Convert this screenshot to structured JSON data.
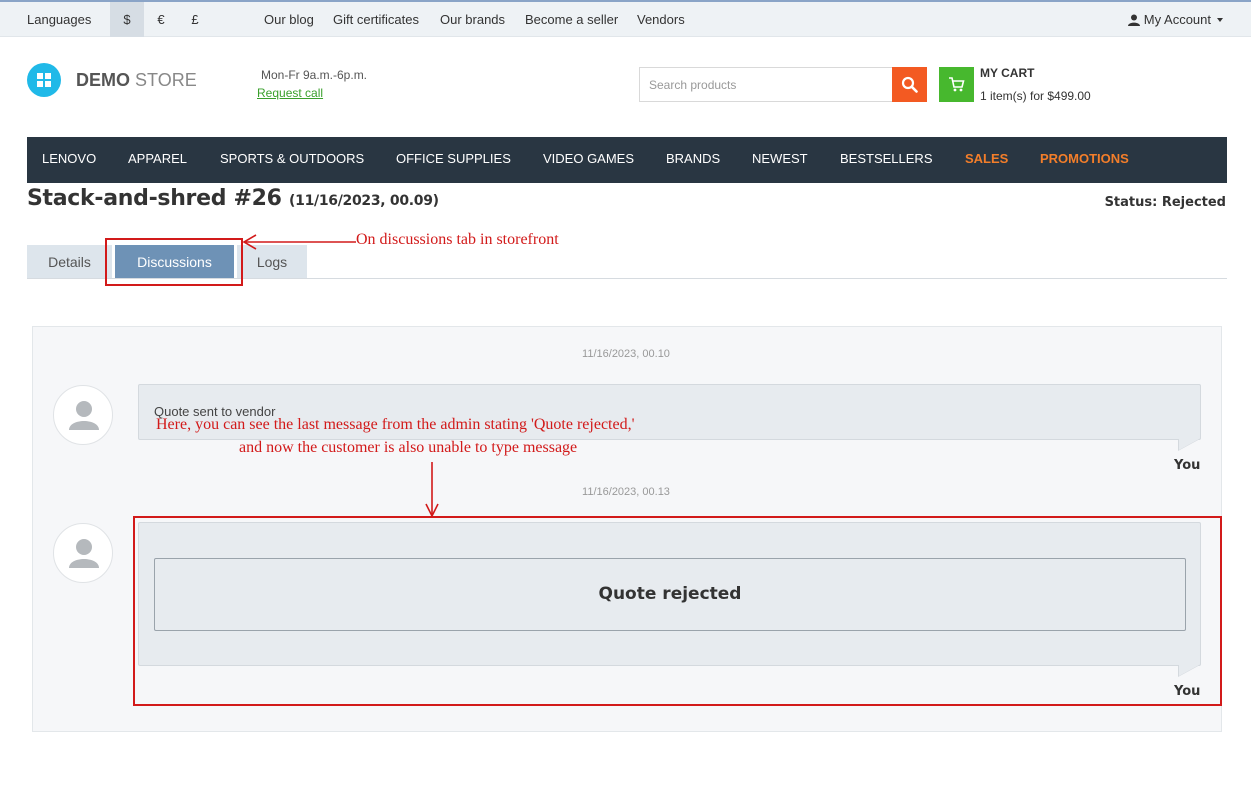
{
  "topbar": {
    "languages": "Languages",
    "currencies": [
      "$",
      "€",
      "£"
    ],
    "links": [
      "Our blog",
      "Gift certificates",
      "Our brands",
      "Become a seller",
      "Vendors"
    ],
    "account": "My Account"
  },
  "header": {
    "brand_bold": "DEMO",
    "brand_light": "STORE",
    "hours": "Mon-Fr 9a.m.-6p.m.",
    "request_call": "Request call",
    "search_placeholder": "Search products",
    "cart_title": "MY CART",
    "cart_summary": "1 item(s) for $499.00"
  },
  "nav": [
    "LENOVO",
    "APPAREL",
    "SPORTS & OUTDOORS",
    "OFFICE SUPPLIES",
    "VIDEO GAMES",
    "BRANDS",
    "NEWEST",
    "BESTSELLERS",
    "SALES",
    "PROMOTIONS"
  ],
  "page": {
    "title": "Stack-and-shred #26",
    "date": "(11/16/2023, 00.09)",
    "status": "Status: Rejected"
  },
  "tabs": [
    "Details",
    "Discussions",
    "Logs"
  ],
  "annotations": {
    "tab_note": "On discussions tab in storefront",
    "message_note_1": "Here, you can see the last message from the admin stating 'Quote rejected,'",
    "message_note_2": "and now the customer is also unable to type message"
  },
  "messages": [
    {
      "timestamp": "11/16/2023, 00.10",
      "text": "Quote sent to vendor",
      "author": "You"
    },
    {
      "timestamp": "11/16/2023, 00.13",
      "text": "Quote rejected",
      "author": "You"
    }
  ],
  "colors": {
    "nav_bg": "#293642",
    "nav_hot": "#f37e2a",
    "search_btn": "#f35a22",
    "cart_btn": "#47b82e",
    "tab_active": "#6e92b6",
    "annotation": "#d21a1a",
    "logo": "#20b9e8"
  },
  "icons": [
    "user-icon",
    "windows-logo-icon",
    "search-icon",
    "cart-icon",
    "avatar-icon",
    "arrow-icon"
  ]
}
